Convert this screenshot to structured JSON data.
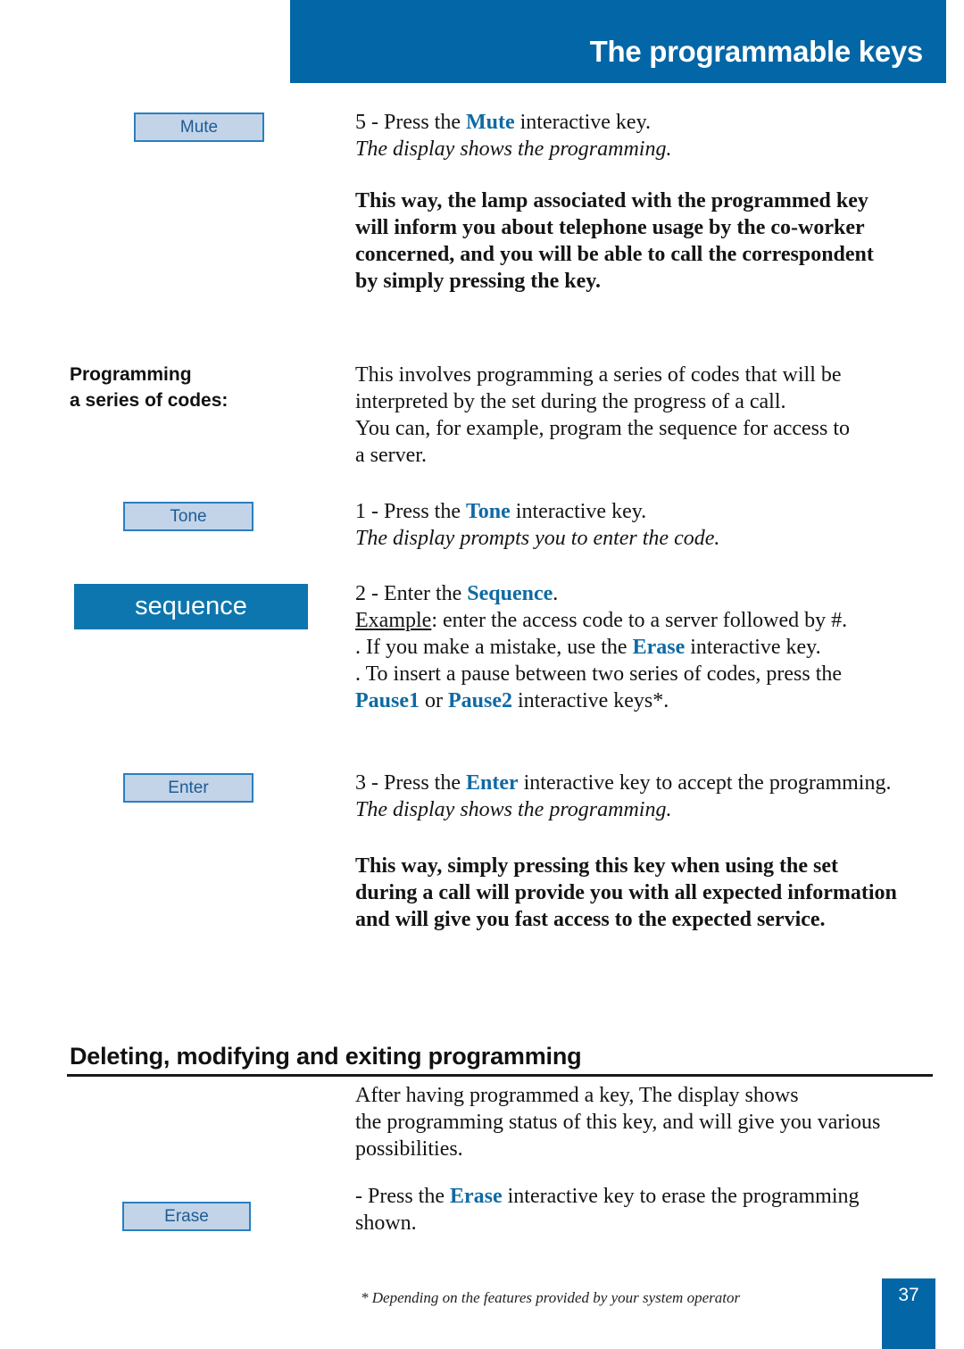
{
  "header": {
    "title": "The programmable keys",
    "band_color": "#0366a6"
  },
  "keys": {
    "mute": "Mute",
    "tone": "Tone",
    "enter": "Enter",
    "erase": "Erase",
    "sequence_display": "sequence"
  },
  "accent_color": "#0f6aa3",
  "key_fill_color": "#c3d4e8",
  "key_border_color": "#2a7fc1",
  "sections": {
    "programming_label": {
      "line1": "Programming",
      "line2": "a series of codes:"
    },
    "deleting_heading": "Deleting, modifying and exiting programming"
  },
  "body": {
    "step5": {
      "l1_pre": "5 - Press the ",
      "l1_key": "Mute",
      "l1_post": " interactive key.",
      "l2": "The display shows the programming."
    },
    "thisway1": {
      "l1": "This way, the lamp associated with the programmed key",
      "l2": "will inform you about telephone usage by the co-worker",
      "l3": "concerned, and you will be able to call the correspondent",
      "l4": "by simply pressing the key."
    },
    "intro": {
      "l1": "This involves programming a series of codes that will be",
      "l2": "interpreted by the set during the progress of a call.",
      "l3": "You can, for example, program the sequence for access to",
      "l4": "a server."
    },
    "step1": {
      "l1_pre": "1 - Press the ",
      "l1_key": "Tone",
      "l1_post": " interactive key.",
      "l2": "The display prompts you to enter the code."
    },
    "step2": {
      "l1_pre": "2 - Enter the ",
      "l1_key": "Sequence",
      "l1_post": ".",
      "l2_label": "Example",
      "l2_rest": ": enter the access code to a server followed by #.",
      "l3_pre": ". If you make a mistake, use the ",
      "l3_key": "Erase",
      "l3_post": " interactive key.",
      "l4": ". To insert a pause between two series of codes, press the",
      "l5_key1": "Pause1",
      "l5_mid": " or ",
      "l5_key2": "Pause2",
      "l5_post": " interactive keys*."
    },
    "step3": {
      "l1_pre": "3 - Press the ",
      "l1_key": "Enter",
      "l1_post": " interactive key to accept the programming.",
      "l2": "The display shows the programming."
    },
    "thisway2": {
      "l1": "This way, simply pressing this key when using the set",
      "l2": "during a call will provide you with all expected information",
      "l3": "and will give you fast access to the expected service."
    },
    "after": {
      "l1": "After having programmed a key, The display shows",
      "l2": "the programming status of this key, and will give you various",
      "l3": "possibilities."
    },
    "erase_step": {
      "l1_pre": "- Press the ",
      "l1_key": "Erase",
      "l1_post": " interactive key to erase the programming",
      "l2": "shown."
    }
  },
  "footer": {
    "footnote": "* Depending on the features provided by your system operator",
    "page_number": "37"
  }
}
